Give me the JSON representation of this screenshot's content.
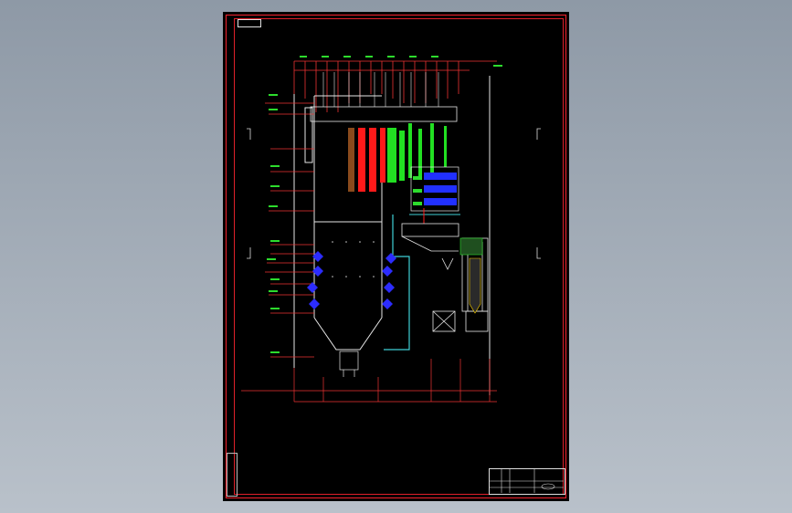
{
  "drawing": {
    "sheet_tag": "",
    "notes": [
      "",
      "",
      "",
      "",
      ""
    ],
    "title_block": {
      "company": "",
      "drawing_name": "",
      "project": "",
      "scale": ""
    }
  },
  "colors": {
    "paper": "#000000",
    "frame": "#e0202a",
    "background": "#9aa4ae",
    "superheater": "#ff1a1a",
    "reheater": "#22e022",
    "economizer": "#2130ff",
    "burner": "#2c2cff",
    "line": "#e6e6e6",
    "duct": "#3fd0d6",
    "hopper": "#ffd400"
  }
}
